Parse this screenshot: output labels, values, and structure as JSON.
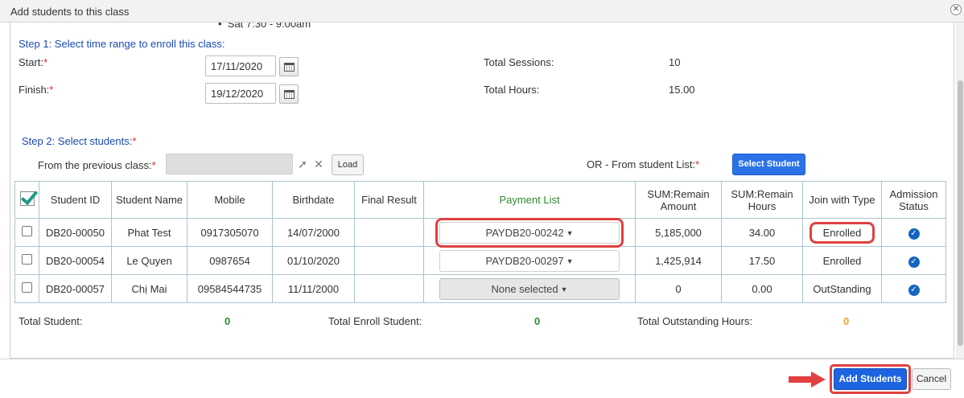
{
  "dialog": {
    "title": "Add students to this class",
    "close_icon": "close-icon"
  },
  "schedule": {
    "bullet": "Sat 7:30 - 9:00am"
  },
  "step1": {
    "heading": "Step 1: Select time range to enroll this class:",
    "start_label": "Start:",
    "start_value": "17/11/2020",
    "finish_label": "Finish:",
    "finish_value": "19/12/2020",
    "total_sessions_label": "Total Sessions:",
    "total_sessions_value": "10",
    "total_hours_label": "Total Hours:",
    "total_hours_value": "15.00",
    "required_mark": "*"
  },
  "step2": {
    "heading": "Step 2: Select students:",
    "required_mark": "*",
    "prev_class_label": "From the previous class:",
    "load_label": "Load",
    "or_label": "OR - From student List:",
    "select_student_label": "Select Student"
  },
  "table": {
    "headers": {
      "student_id": "Student ID",
      "student_name": "Student Name",
      "mobile": "Mobile",
      "birthdate": "Birthdate",
      "final_result": "Final Result",
      "payment_list": "Payment List",
      "sum_amount": "SUM:Remain Amount",
      "sum_hours": "SUM:Remain Hours",
      "join_type": "Join with Type",
      "admission": "Admission Status"
    },
    "rows": [
      {
        "id": "DB20-00050",
        "name": "Phat Test",
        "mobile": "0917305070",
        "birthdate": "14/07/2000",
        "final_result": "",
        "payment": "PAYDB20-00242",
        "amount": "5,185,000",
        "hours": "34.00",
        "join_type": "Enrolled"
      },
      {
        "id": "DB20-00054",
        "name": "Le Quyen",
        "mobile": "0987654",
        "birthdate": "01/10/2020",
        "final_result": "",
        "payment": "PAYDB20-00297",
        "amount": "1,425,914",
        "hours": "17.50",
        "join_type": "Enrolled"
      },
      {
        "id": "DB20-00057",
        "name": "Chị Mai",
        "mobile": "09584544735",
        "birthdate": "11/11/2000",
        "final_result": "",
        "payment": "None selected",
        "amount": "0",
        "hours": "0.00",
        "join_type": "OutStanding"
      }
    ]
  },
  "totals": {
    "total_student_label": "Total Student:",
    "total_student_value": "0",
    "total_enroll_label": "Total Enroll Student:",
    "total_enroll_value": "0",
    "total_outstanding_label": "Total Outstanding Hours:",
    "total_outstanding_value": "0"
  },
  "footer": {
    "add_label": "Add Students",
    "cancel_label": "Cancel"
  },
  "colors": {
    "accent": "#1d64e0",
    "highlight": "#e04040",
    "enrolled": "#2e8b2e",
    "outstanding": "#f0a030",
    "step": "#1a49b3"
  }
}
